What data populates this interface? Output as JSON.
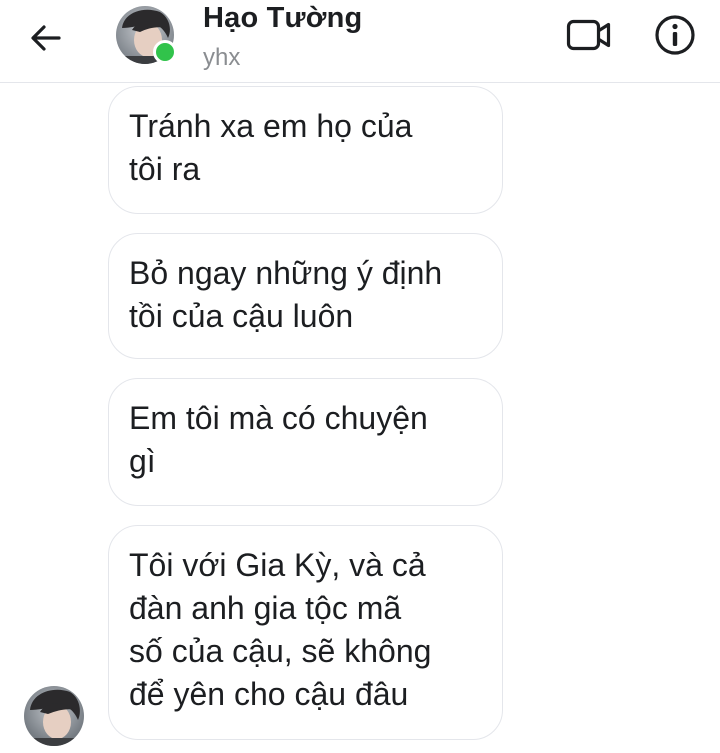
{
  "header": {
    "contact_name": "Hạo Tường",
    "contact_subtitle": "yhx",
    "online_status_color": "#31c34b",
    "icons": {
      "back": "arrow-left-icon",
      "video": "video-camera-icon",
      "info": "info-circle-icon"
    }
  },
  "messages": [
    {
      "text": "Tránh xa em họ của\ntôi ra"
    },
    {
      "text": "Bỏ ngay những ý định\ntồi của cậu luôn"
    },
    {
      "text": "Em tôi mà có chuyện\ngì"
    },
    {
      "text": "Tôi với Gia Kỳ, và cả\nđàn anh gia tộc mã\nsố của cậu, sẽ không\nđể yên cho cậu đâu"
    }
  ],
  "colors": {
    "bubble_border": "#e4e6eb",
    "text": "#1c1e21",
    "subtitle": "#8a8d91"
  }
}
